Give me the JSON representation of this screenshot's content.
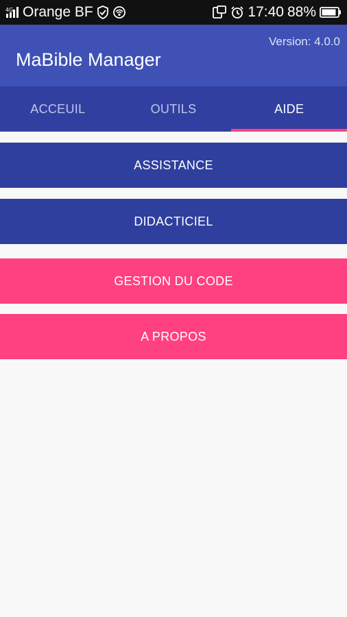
{
  "status_bar": {
    "carrier": "Orange BF",
    "time": "17:40",
    "battery": "88%",
    "icons": [
      "signal-icon",
      "shield-icon",
      "wifi-icon",
      "screen-rotation-icon",
      "alarm-icon",
      "battery-icon"
    ]
  },
  "app_bar": {
    "version": "Version: 4.0.0",
    "title": "MaBible Manager"
  },
  "tabs": [
    {
      "label": "ACCEUIL",
      "active": false
    },
    {
      "label": "OUTILS",
      "active": false
    },
    {
      "label": "AIDE",
      "active": true
    }
  ],
  "buttons": [
    {
      "label": "ASSISTANCE",
      "color": "#2f3f9e"
    },
    {
      "label": "DIDACTICIEL",
      "color": "#2f3f9e"
    },
    {
      "label": "GESTION DU CODE",
      "color": "#ff4081"
    },
    {
      "label": "A PROPOS",
      "color": "#ff4081"
    }
  ],
  "colors": {
    "primary": "#3f51b5",
    "tab_bar": "#3140a0",
    "accent": "#ff4081",
    "background": "#f8f8f8"
  }
}
